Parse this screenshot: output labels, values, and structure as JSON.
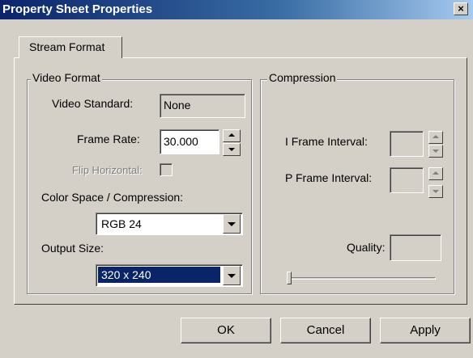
{
  "window": {
    "title": "Property Sheet Properties",
    "close_glyph": "×"
  },
  "tabs": [
    {
      "label": "Stream Format",
      "selected": true
    }
  ],
  "video_format": {
    "legend": "Video Format",
    "video_standard_label": "Video Standard:",
    "video_standard_value": "None",
    "frame_rate_label": "Frame Rate:",
    "frame_rate_value": "30.000",
    "flip_horizontal_label": "Flip Horizontal:",
    "flip_horizontal_checked": false,
    "color_space_label": "Color Space / Compression:",
    "color_space_value": "RGB 24",
    "output_size_label": "Output Size:",
    "output_size_value": "320 x 240"
  },
  "compression": {
    "legend": "Compression",
    "i_frame_label": "I Frame Interval:",
    "i_frame_value": "",
    "p_frame_label": "P Frame Interval:",
    "p_frame_value": "",
    "quality_label": "Quality:",
    "quality_value": ""
  },
  "buttons": {
    "ok": "OK",
    "cancel": "Cancel",
    "apply": "Apply"
  },
  "colors": {
    "face": "#d4d0c8",
    "title_active": "#0a246a",
    "selection": "#0a246a"
  }
}
